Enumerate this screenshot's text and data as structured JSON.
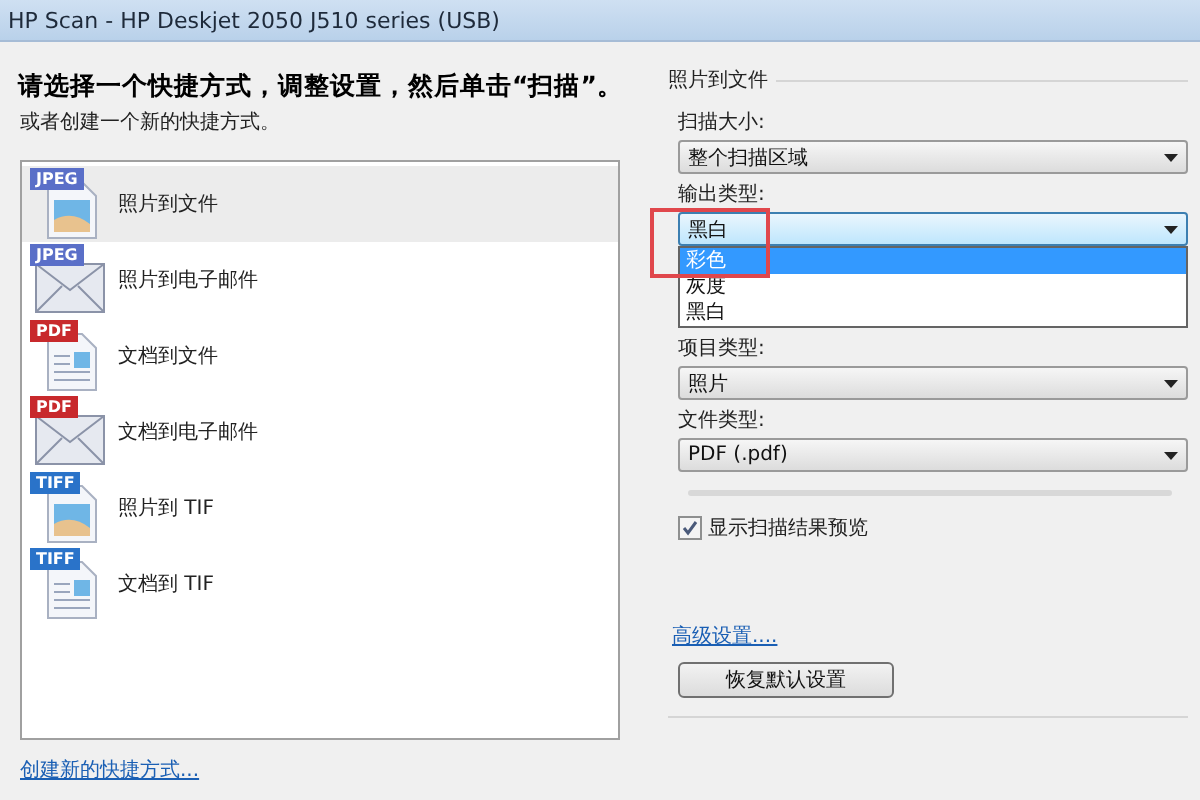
{
  "window": {
    "title": "HP Scan - HP Deskjet 2050 J510 series (USB)"
  },
  "heading": "请选择一个快捷方式，调整设置，然后单击“扫描”。",
  "subheading": "或者创建一个新的快捷方式。",
  "shortcuts": [
    {
      "label": "照片到文件",
      "badge": "JPEG",
      "kind": "photo",
      "selected": true
    },
    {
      "label": "照片到电子邮件",
      "badge": "JPEG",
      "kind": "email",
      "selected": false
    },
    {
      "label": "文档到文件",
      "badge": "PDF",
      "kind": "document",
      "selected": false
    },
    {
      "label": "文档到电子邮件",
      "badge": "PDF",
      "kind": "email",
      "selected": false
    },
    {
      "label": "照片到 TIF",
      "badge": "TIFF",
      "kind": "photo",
      "selected": false
    },
    {
      "label": "文档到 TIF",
      "badge": "TIFF",
      "kind": "document",
      "selected": false
    }
  ],
  "create_link": "创建新的快捷方式...",
  "settings": {
    "title": "照片到文件",
    "fields": [
      {
        "label": "扫描大小:",
        "value": "整个扫描区域",
        "open": false
      },
      {
        "label": "输出类型:",
        "value": "黑白",
        "open": true,
        "options": [
          {
            "label": "彩色",
            "highlighted": true
          },
          {
            "label": "灰度",
            "highlighted": false
          },
          {
            "label": "黑白",
            "highlighted": false
          }
        ]
      },
      {
        "label": "项目类型:",
        "value": "照片",
        "open": false
      },
      {
        "label": "文件类型:",
        "value": "PDF (.pdf)",
        "open": false
      }
    ],
    "preview_checkbox": {
      "label": "显示扫描结果预览",
      "checked": true
    },
    "advanced_link": "高级设置....",
    "reset_button": "恢复默认设置"
  }
}
